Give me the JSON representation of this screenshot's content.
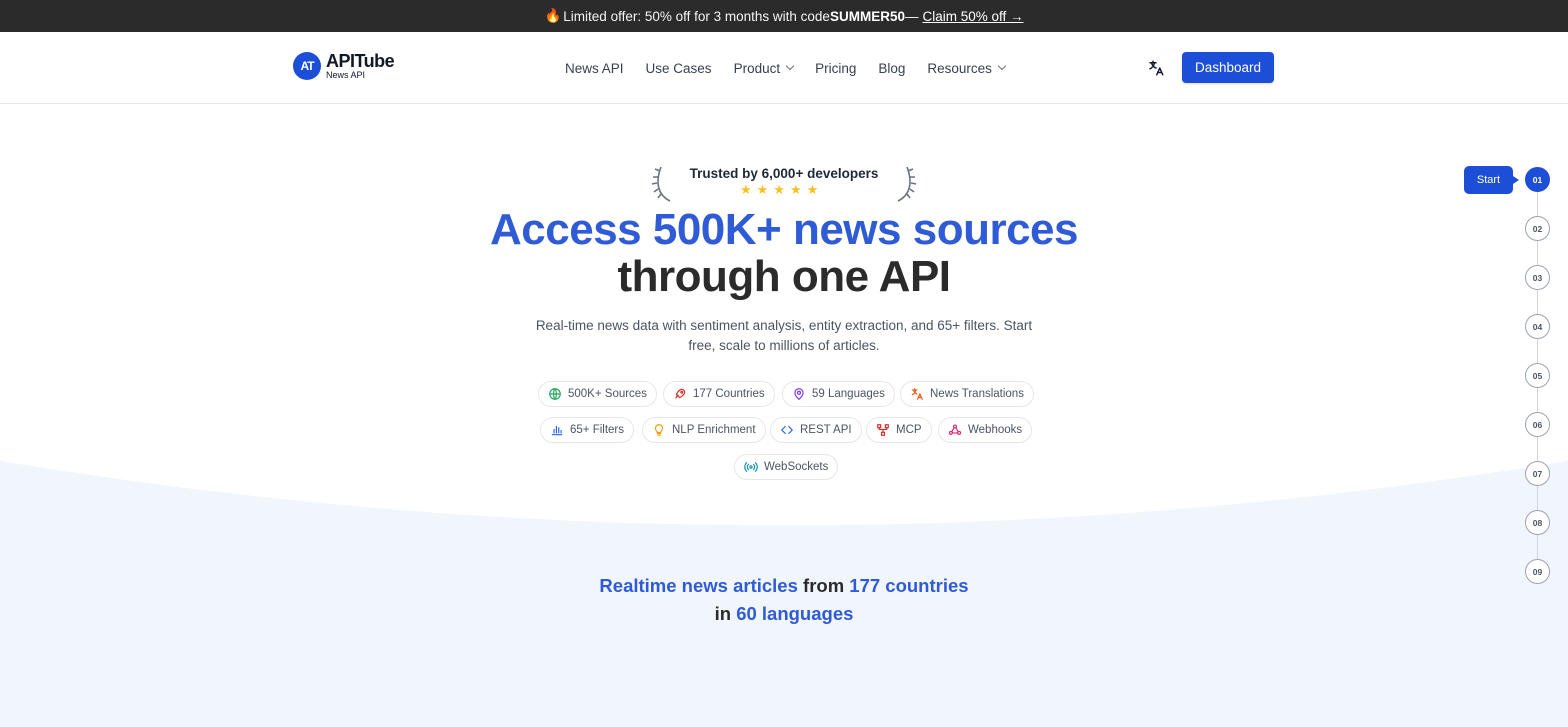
{
  "promo": {
    "text": "Limited offer: 50% off for 3 months with code ",
    "code": "SUMMER50",
    "dash": " —",
    "link": "Claim 50% off →"
  },
  "brand": {
    "name": "APITube",
    "sub": "News API",
    "mark": "AT"
  },
  "nav": {
    "items": [
      {
        "label": "News API",
        "dropdown": false
      },
      {
        "label": "Use Cases",
        "dropdown": false
      },
      {
        "label": "Product",
        "dropdown": true
      },
      {
        "label": "Pricing",
        "dropdown": false
      },
      {
        "label": "Blog",
        "dropdown": false
      },
      {
        "label": "Resources",
        "dropdown": true
      }
    ],
    "dashboard": "Dashboard"
  },
  "hero": {
    "trust": "Trusted by 6,000+ developers",
    "rating_stars": 5,
    "headline_1": "Access 500K+ news sources",
    "headline_2": "through one API",
    "subtitle": "Real-time news data with sentiment analysis, entity extraction, and 65+ filters. Start free, scale to millions of articles."
  },
  "features": [
    {
      "label": "500K+ Sources",
      "icon": "globe-icon",
      "color": "#22a55a"
    },
    {
      "label": "177 Countries",
      "icon": "rocket-icon",
      "color": "#dc2626"
    },
    {
      "label": "59 Languages",
      "icon": "map-pin-icon",
      "color": "#7c3aed"
    },
    {
      "label": "News Translations",
      "icon": "translate-icon",
      "color": "#ea580c"
    },
    {
      "label": "65+ Filters",
      "icon": "bar-chart-icon",
      "color": "#2563eb"
    },
    {
      "label": "NLP Enrichment",
      "icon": "lightbulb-icon",
      "color": "#f59e0b"
    },
    {
      "label": "REST API",
      "icon": "code-icon",
      "color": "#2563eb"
    },
    {
      "label": "MCP",
      "icon": "fork-icon",
      "color": "#dc2626"
    },
    {
      "label": "Webhooks",
      "icon": "webhook-icon",
      "color": "#db2777"
    },
    {
      "label": "WebSockets",
      "icon": "broadcast-icon",
      "color": "#0891b2"
    }
  ],
  "stepper": {
    "tooltip": "Start",
    "steps": [
      "01",
      "02",
      "03",
      "04",
      "05",
      "06",
      "07",
      "08",
      "09"
    ],
    "active": "01"
  },
  "tagline": {
    "a": "Realtime news articles",
    "b": " from ",
    "c": "177 countries",
    "d": "in ",
    "e": "60 languages"
  },
  "colors": {
    "accent": "#1d4ed8",
    "headline_blue": "#2f5bd6",
    "section_bg": "#f1f5fc",
    "promo_bg": "#2b2b2b"
  }
}
